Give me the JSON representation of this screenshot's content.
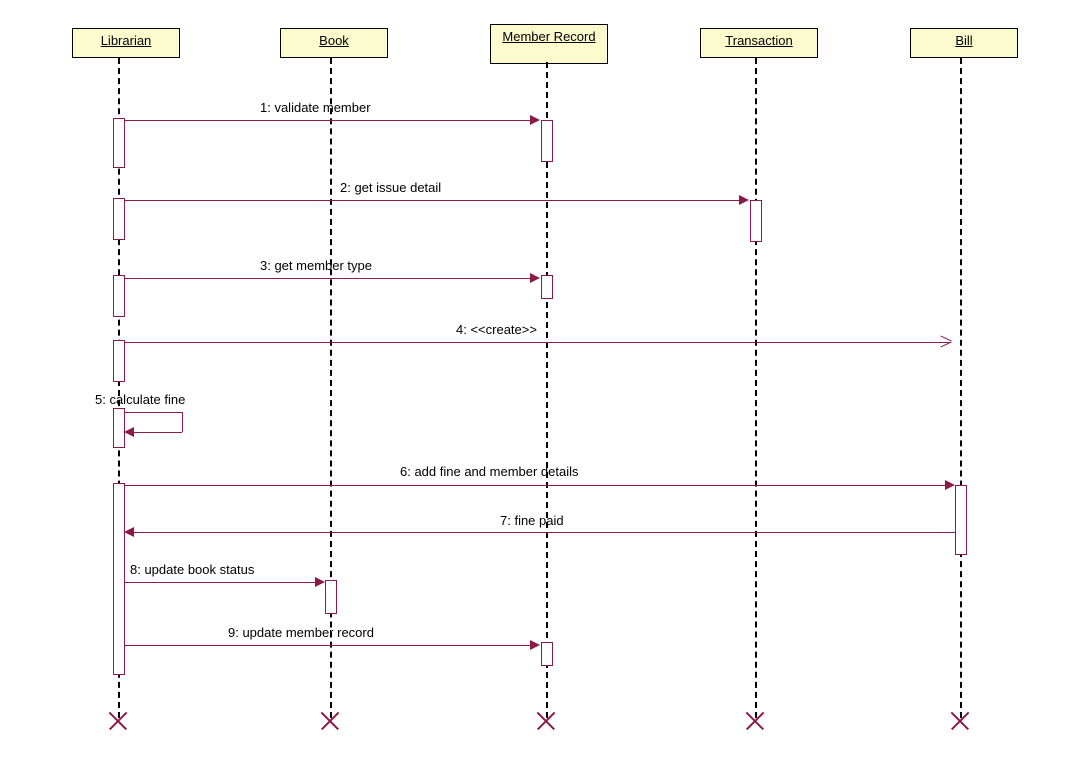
{
  "participants": [
    {
      "id": "librarian",
      "label": "Librarian"
    },
    {
      "id": "book",
      "label": "Book"
    },
    {
      "id": "memberrecord",
      "label": "Member Record"
    },
    {
      "id": "transaction",
      "label": "Transaction"
    },
    {
      "id": "bill",
      "label": "Bill"
    }
  ],
  "messages": {
    "m1": "1: validate member",
    "m2": "2: get issue detail",
    "m3": "3: get member type",
    "m4": "4: <<create>>",
    "m5": "5: calculate fine",
    "m6": "6: add fine and member details",
    "m7": "7: fine paid",
    "m8": "8: update book status",
    "m9": "9: update member record"
  }
}
